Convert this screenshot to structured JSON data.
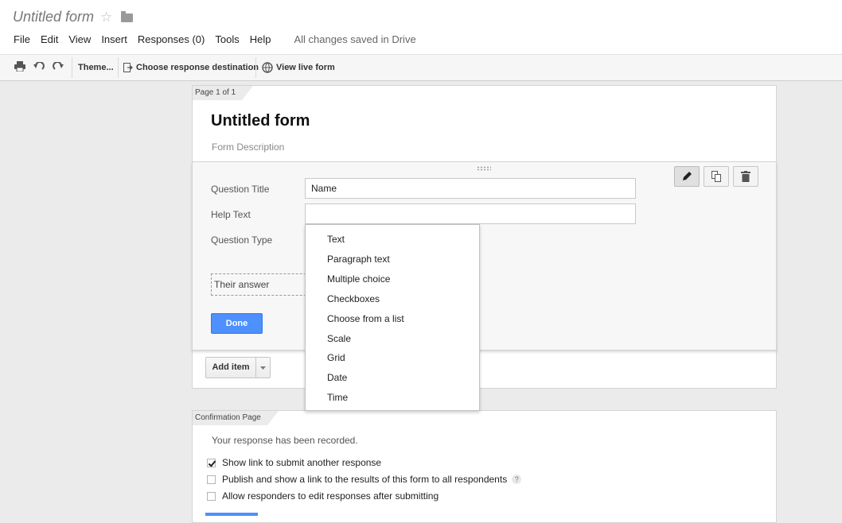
{
  "header": {
    "title": "Untitled form",
    "menu": [
      "File",
      "Edit",
      "View",
      "Insert",
      "Responses (0)",
      "Tools",
      "Help"
    ],
    "save_status": "All changes saved in Drive"
  },
  "toolbar": {
    "icons": [
      "print-icon",
      "undo-icon",
      "redo-icon"
    ],
    "theme_label": "Theme...",
    "destination_label": "Choose response destination",
    "live_form_label": "View live form"
  },
  "form": {
    "page_tab": "Page 1 of 1",
    "title": "Untitled form",
    "description": "Form Description",
    "question": {
      "title_label": "Question Title",
      "title_value": "Name",
      "help_label": "Help Text",
      "help_value": "",
      "type_label": "Question Type",
      "answer_preview": "Their answer",
      "done_label": "Done"
    },
    "add_item_label": "Add item"
  },
  "type_menu": {
    "options": [
      "Text",
      "Paragraph text",
      "Multiple choice",
      "Checkboxes",
      "Choose from a list",
      "Scale",
      "Grid",
      "Date",
      "Time"
    ]
  },
  "confirmation": {
    "tab": "Confirmation Page",
    "recorded_text": "Your response has been recorded.",
    "options": [
      {
        "label": "Show link to submit another response",
        "checked": true
      },
      {
        "label": "Publish and show a link to the results of this form to all respondents",
        "checked": false
      },
      {
        "label": "Allow responders to edit responses after submitting",
        "checked": false
      }
    ],
    "help_mark": "?"
  },
  "colors": {
    "accent_blue": "#4d90fe",
    "background": "#ebebeb"
  }
}
